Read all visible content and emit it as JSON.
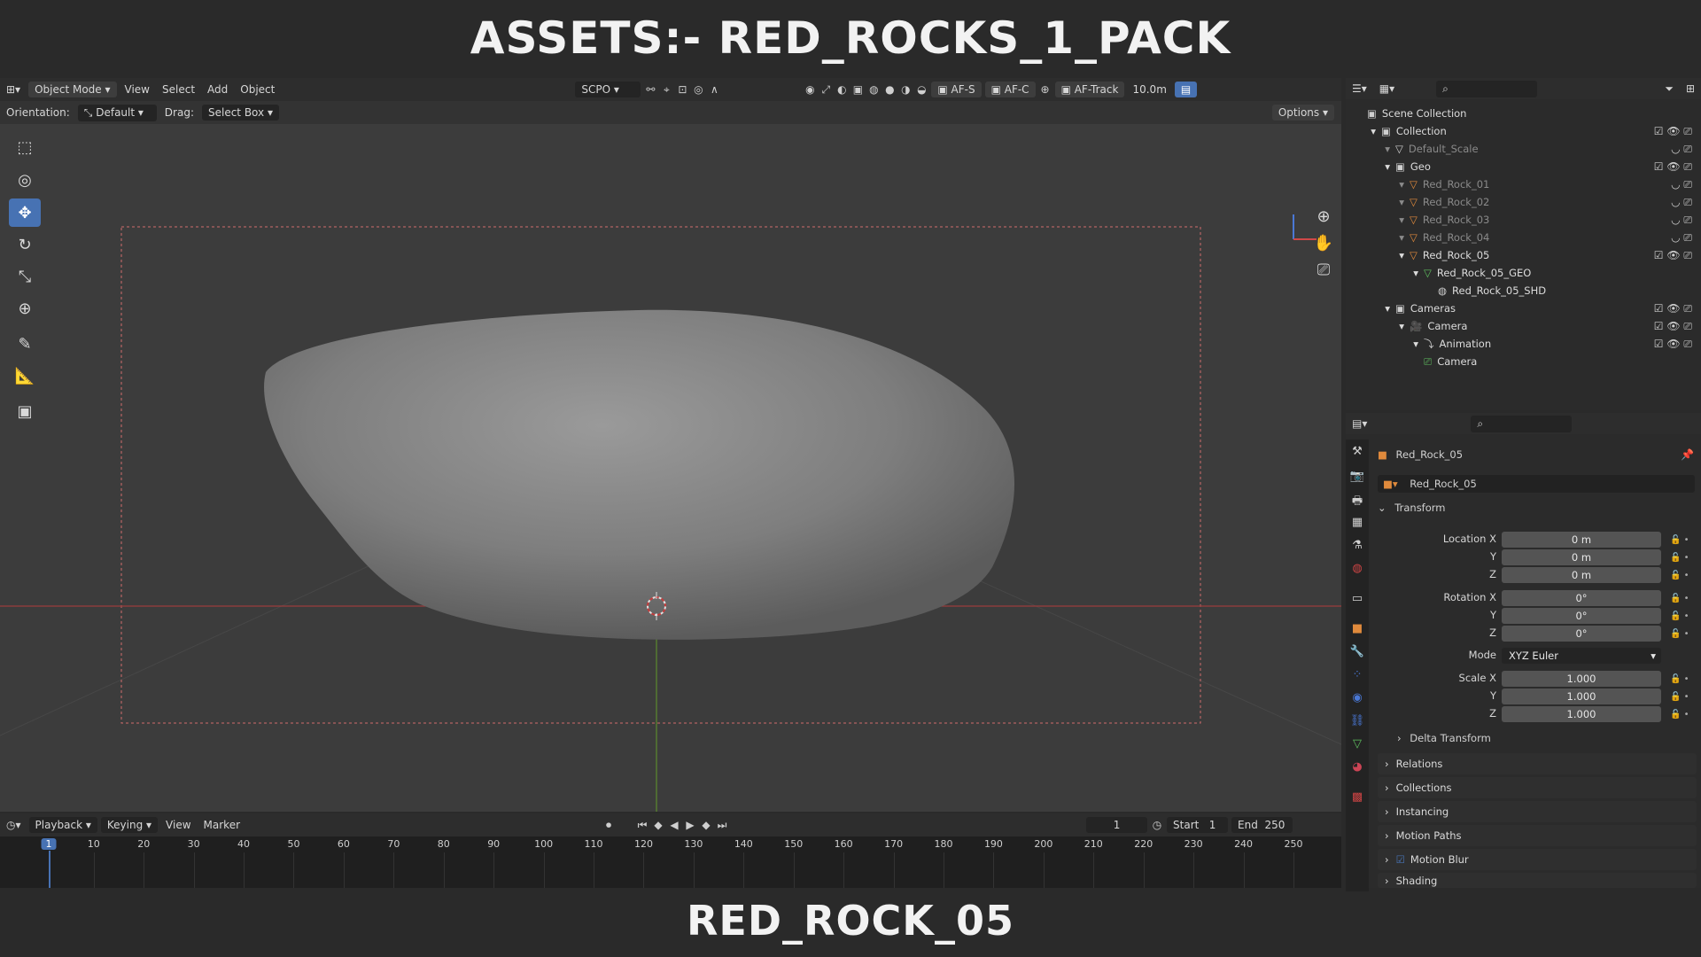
{
  "titles": {
    "top": "ASSETS:- RED_ROCKS_1_PACK",
    "bottom": "RED_ROCK_05"
  },
  "viewport_header": {
    "editor_icon": "3d-viewport-icon",
    "mode": "Object Mode",
    "menus": [
      "View",
      "Select",
      "Add",
      "Object"
    ],
    "camera_name": "SCPO",
    "camera_buttons": [
      "AF-S",
      "AF-C",
      "AF-Track"
    ],
    "focal": "10.0m"
  },
  "tool_header": {
    "orientation_label": "Orientation:",
    "orientation_value": "Default",
    "drag_label": "Drag:",
    "drag_value": "Select Box",
    "options": "Options"
  },
  "toolbar": [
    "select-box-icon",
    "cursor-icon",
    "move-icon",
    "rotate-icon",
    "scale-icon",
    "transform-icon",
    "annotate-icon",
    "measure-icon",
    "add-cube-icon"
  ],
  "outliner": {
    "rows": [
      {
        "label": "Scene Collection",
        "indent": 0,
        "dim": false
      },
      {
        "label": "Collection",
        "indent": 1,
        "dim": false
      },
      {
        "label": "Default_Scale",
        "indent": 2,
        "dim": true
      },
      {
        "label": "Geo",
        "indent": 2,
        "dim": false
      },
      {
        "label": "Red_Rock_01",
        "indent": 3,
        "dim": true
      },
      {
        "label": "Red_Rock_02",
        "indent": 3,
        "dim": true
      },
      {
        "label": "Red_Rock_03",
        "indent": 3,
        "dim": true
      },
      {
        "label": "Red_Rock_04",
        "indent": 3,
        "dim": true
      },
      {
        "label": "Red_Rock_05",
        "indent": 3,
        "dim": false
      },
      {
        "label": "Red_Rock_05_GEO",
        "indent": 4,
        "dim": false
      },
      {
        "label": "Red_Rock_05_SHD",
        "indent": 5,
        "dim": false
      },
      {
        "label": "Cameras",
        "indent": 2,
        "dim": false
      },
      {
        "label": "Camera",
        "indent": 3,
        "dim": false
      },
      {
        "label": "Animation",
        "indent": 4,
        "dim": false
      },
      {
        "label": "Camera",
        "indent": 4,
        "dim": false
      }
    ]
  },
  "properties": {
    "object_name": "Red_Rock_05",
    "datablock_name": "Red_Rock_05",
    "transform_title": "Transform",
    "location": {
      "label": "Location X",
      "x": "0 m",
      "y": "0 m",
      "z": "0 m"
    },
    "rotation": {
      "label": "Rotation X",
      "x": "0°",
      "y": "0°",
      "z": "0°"
    },
    "mode_label": "Mode",
    "mode_value": "XYZ Euler",
    "scale": {
      "label": "Scale X",
      "x": "1.000",
      "y": "1.000",
      "z": "1.000"
    },
    "axis_y": "Y",
    "axis_z": "Z",
    "delta": "Delta Transform",
    "panels": [
      "Relations",
      "Collections",
      "Instancing",
      "Motion Paths",
      "Motion Blur",
      "Shading"
    ]
  },
  "timeline": {
    "menus": [
      "Playback",
      "Keying",
      "View",
      "Marker"
    ],
    "current_frame": "1",
    "start_label": "Start",
    "start": "1",
    "end_label": "End",
    "end": "250",
    "ticks": [
      "1",
      "10",
      "20",
      "30",
      "40",
      "50",
      "60",
      "70",
      "80",
      "90",
      "100",
      "110",
      "120",
      "130",
      "140",
      "150",
      "160",
      "170",
      "180",
      "190",
      "200",
      "210",
      "220",
      "230",
      "240",
      "250"
    ]
  }
}
